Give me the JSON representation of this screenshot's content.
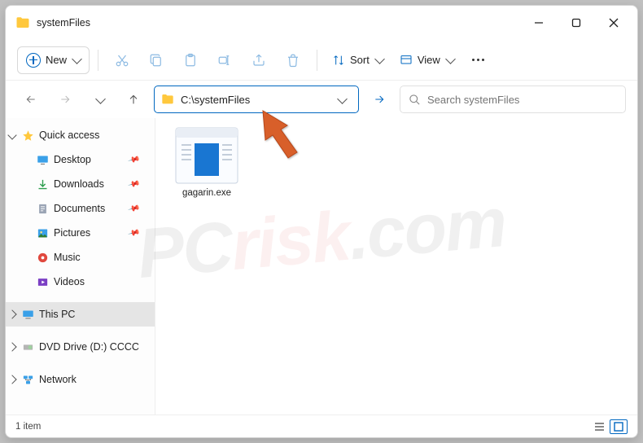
{
  "title": "systemFiles",
  "toolbar": {
    "new": "New",
    "sort": "Sort",
    "view": "View"
  },
  "addressbar": {
    "path": "C:\\systemFiles"
  },
  "search": {
    "placeholder": "Search systemFiles"
  },
  "sidebar": {
    "quickaccess": "Quick access",
    "desktop": "Desktop",
    "downloads": "Downloads",
    "documents": "Documents",
    "pictures": "Pictures",
    "music": "Music",
    "videos": "Videos",
    "thispc": "This PC",
    "dvd": "DVD Drive (D:) CCCC",
    "network": "Network"
  },
  "files": [
    {
      "name": "gagarin.exe"
    }
  ],
  "status": {
    "count": "1 item"
  },
  "watermark": {
    "pc": "PC",
    "risk": "risk",
    "dom": ".com"
  }
}
